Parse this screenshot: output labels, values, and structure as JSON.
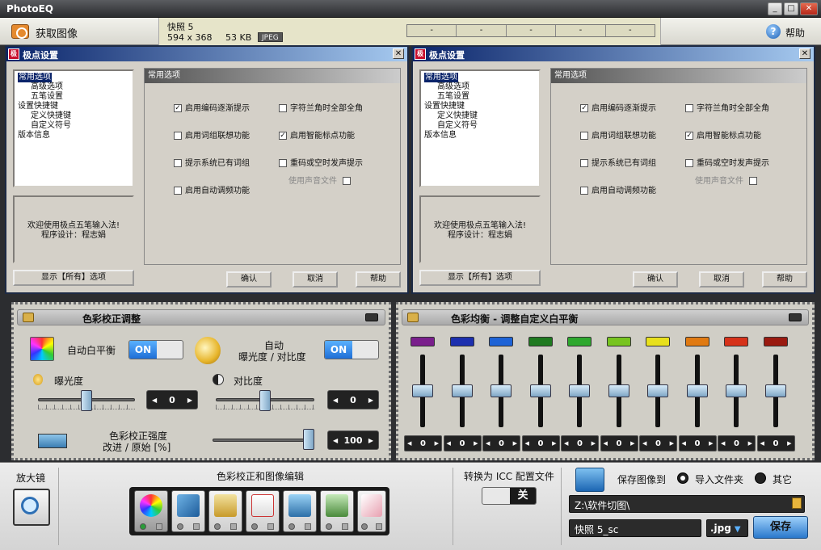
{
  "window": {
    "title": "PhotoEQ"
  },
  "toolbar": {
    "get_image": "获取图像",
    "help": "帮助"
  },
  "image_info": {
    "filename": "快照 5",
    "dimensions": "594 x 368",
    "size": "53 KB",
    "format": "JPEG",
    "segments": [
      "-",
      "-",
      "-",
      "-",
      "-"
    ]
  },
  "dialog": {
    "title": "极点设置",
    "tree": [
      {
        "label": "常用选项",
        "level": 1,
        "selected": true
      },
      {
        "label": "高级选项",
        "level": 2
      },
      {
        "label": "五笔设置",
        "level": 2
      },
      {
        "label": "设置快捷键",
        "level": 1
      },
      {
        "label": "定义快捷键",
        "level": 2
      },
      {
        "label": "自定义符号",
        "level": 2
      },
      {
        "label": "版本信息",
        "level": 1
      }
    ],
    "welcome_line1": "欢迎使用极点五笔输入法!",
    "welcome_line2": "程序设计：程志娟",
    "show_all": "显示【所有】选项",
    "panel_header": "常用选项",
    "options": [
      {
        "label": "启用编码逐渐提示",
        "checked": true
      },
      {
        "label": "启用词组联想功能",
        "checked": false
      },
      {
        "label": "提示系统已有词组",
        "checked": false
      },
      {
        "label": "启用自动调频功能",
        "checked": false
      },
      {
        "label": "字符兰角时全部全角",
        "checked": false
      },
      {
        "label": "启用智能标点功能",
        "checked": true
      },
      {
        "label": "重码或空时发声提示",
        "checked": false
      }
    ],
    "sound_file": "使用声音文件",
    "ok": "确认",
    "cancel": "取消",
    "help": "帮助"
  },
  "color_correction": {
    "title": "色彩校正调整",
    "auto_wb": "自动白平衡",
    "auto_wb_state": "ON",
    "auto_exposure_line1": "自动",
    "auto_exposure_line2": "曝光度 / 对比度",
    "auto_exposure_state": "ON",
    "exposure_label": "曝光度",
    "exposure_value": "0",
    "exposure_level": 0.5,
    "contrast_label": "对比度",
    "contrast_value": "0",
    "contrast_level": 0.5,
    "strength_line1": "色彩校正强度",
    "strength_line2": "改进 / 原始 [%]",
    "strength_value": "100",
    "strength_level": 1.0
  },
  "white_balance": {
    "title": "色彩均衡 - 调整自定义白平衡",
    "swatches": [
      "#7a1f8c",
      "#1c2fae",
      "#1e63d6",
      "#1f7a20",
      "#2ea82e",
      "#77c41f",
      "#e8e01c",
      "#e07a12",
      "#d6321a",
      "#9a1a10"
    ],
    "values": [
      "0",
      "0",
      "0",
      "0",
      "0",
      "0",
      "0",
      "0",
      "0",
      "0"
    ]
  },
  "bottom": {
    "magnifier": "放大镜",
    "edit_title": "色彩校正和图像编辑",
    "icc_title": "转换为 ICC 配置文件",
    "icc_state": "关",
    "save_to": "保存图像到",
    "import_folder": "导入文件夹",
    "other": "其它",
    "path": "Z:\\软件切图\\",
    "filename": "快照 5_sc",
    "extension": ".jpg",
    "save": "保存"
  }
}
